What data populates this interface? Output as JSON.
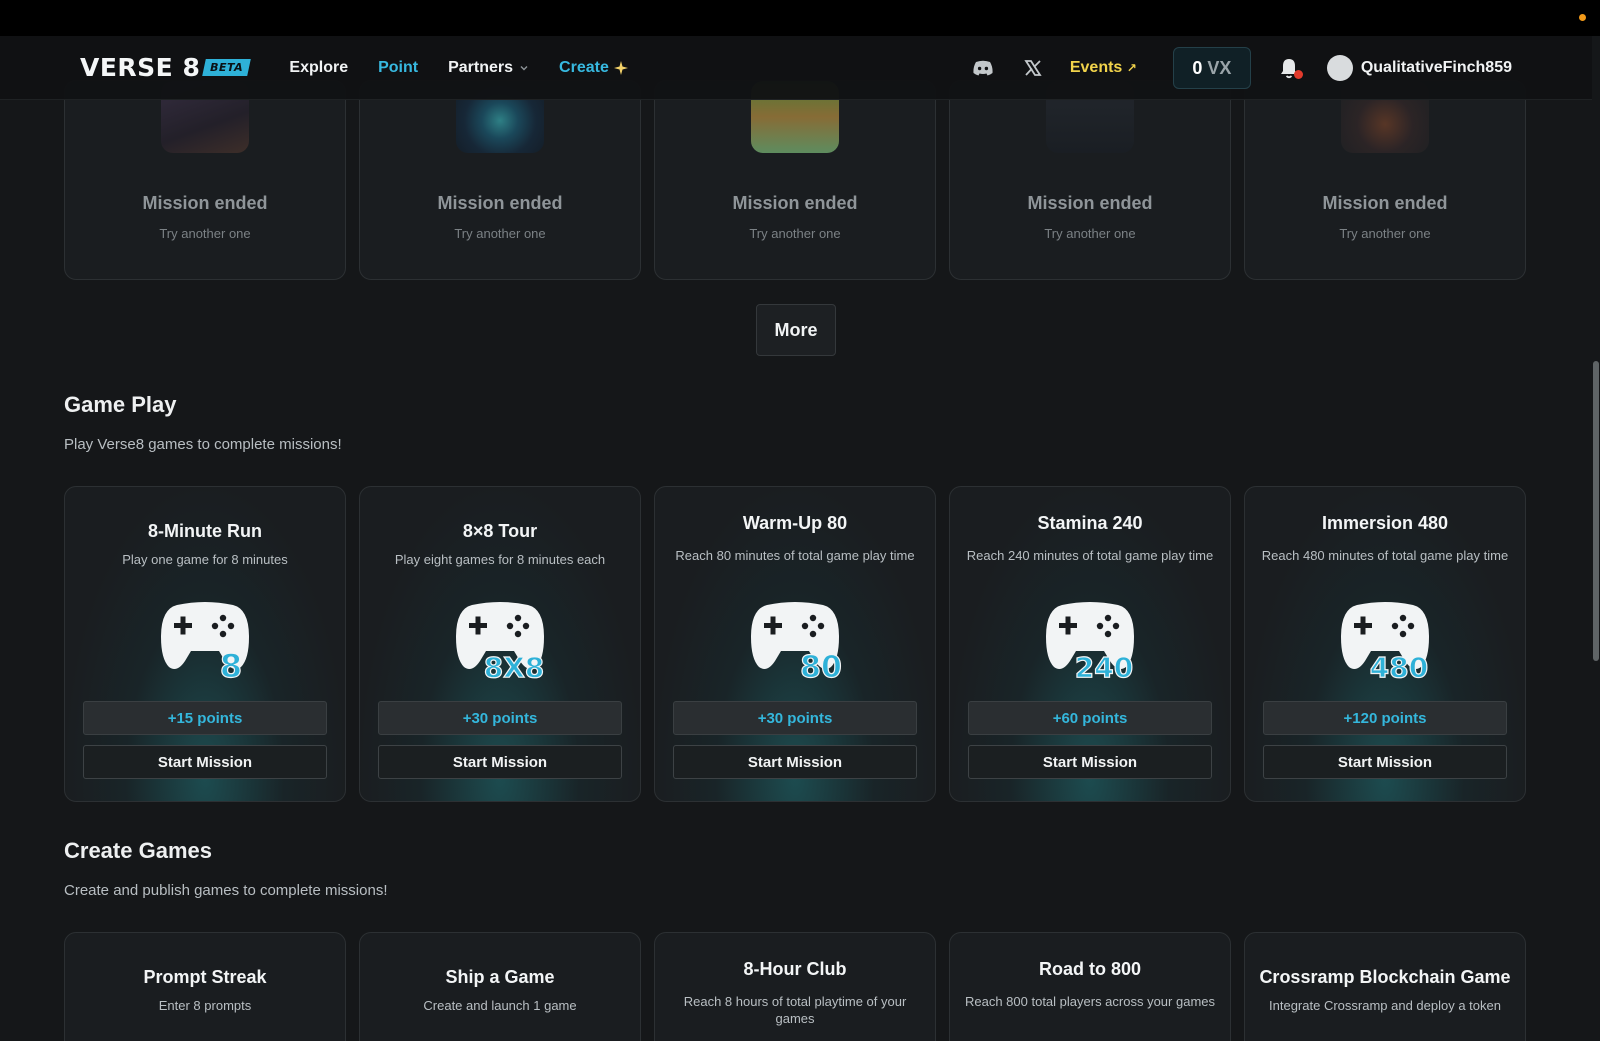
{
  "colors": {
    "accent": "#37b9e0",
    "events": "#f1d34b",
    "background": "#151719"
  },
  "nav": {
    "logo": "VERSE 8",
    "beta": "BETA",
    "items": [
      {
        "label": "Explore"
      },
      {
        "label": "Point"
      },
      {
        "label": "Partners"
      },
      {
        "label": "Create"
      }
    ],
    "events": "Events",
    "events_arrow": "↗",
    "vx_value": "0",
    "vx_unit": "VX",
    "username": "QualitativeFinch859"
  },
  "ended_missions": [
    {
      "title": "Mission ended",
      "sub": "Try another one"
    },
    {
      "title": "Mission ended",
      "sub": "Try another one"
    },
    {
      "title": "Mission ended",
      "sub": "Try another one"
    },
    {
      "title": "Mission ended",
      "sub": "Try another one"
    },
    {
      "title": "Mission ended",
      "sub": "Try another one"
    }
  ],
  "more_label": "More",
  "game_play": {
    "title": "Game Play",
    "subtitle": "Play Verse8 games to complete missions!",
    "missions": [
      {
        "title": "8-Minute Run",
        "desc": "Play one game for 8 minutes",
        "badge": "8",
        "points": "+15 points",
        "action": "Start Mission"
      },
      {
        "title": "8×8 Tour",
        "desc": "Play eight games for 8 minutes each",
        "badge": "8X8",
        "points": "+30 points",
        "action": "Start Mission"
      },
      {
        "title": "Warm-Up 80",
        "desc": "Reach 80 minutes of total game play time",
        "badge": "80",
        "points": "+30 points",
        "action": "Start Mission"
      },
      {
        "title": "Stamina 240",
        "desc": "Reach 240 minutes of total game play time",
        "badge": "240",
        "points": "+60 points",
        "action": "Start Mission"
      },
      {
        "title": "Immersion 480",
        "desc": "Reach 480 minutes of total game play time",
        "badge": "480",
        "points": "+120 points",
        "action": "Start Mission"
      }
    ]
  },
  "create_games": {
    "title": "Create Games",
    "subtitle": "Create and publish games to complete missions!",
    "missions": [
      {
        "title": "Prompt Streak",
        "desc": "Enter 8 prompts"
      },
      {
        "title": "Ship a Game",
        "desc": "Create and launch 1 game"
      },
      {
        "title": "8-Hour Club",
        "desc": "Reach 8 hours of total playtime of your games"
      },
      {
        "title": "Road to 800",
        "desc": "Reach 800 total players across your games"
      },
      {
        "title": "Crossramp Blockchain Game",
        "desc": "Integrate Crossramp and deploy a token"
      }
    ]
  }
}
